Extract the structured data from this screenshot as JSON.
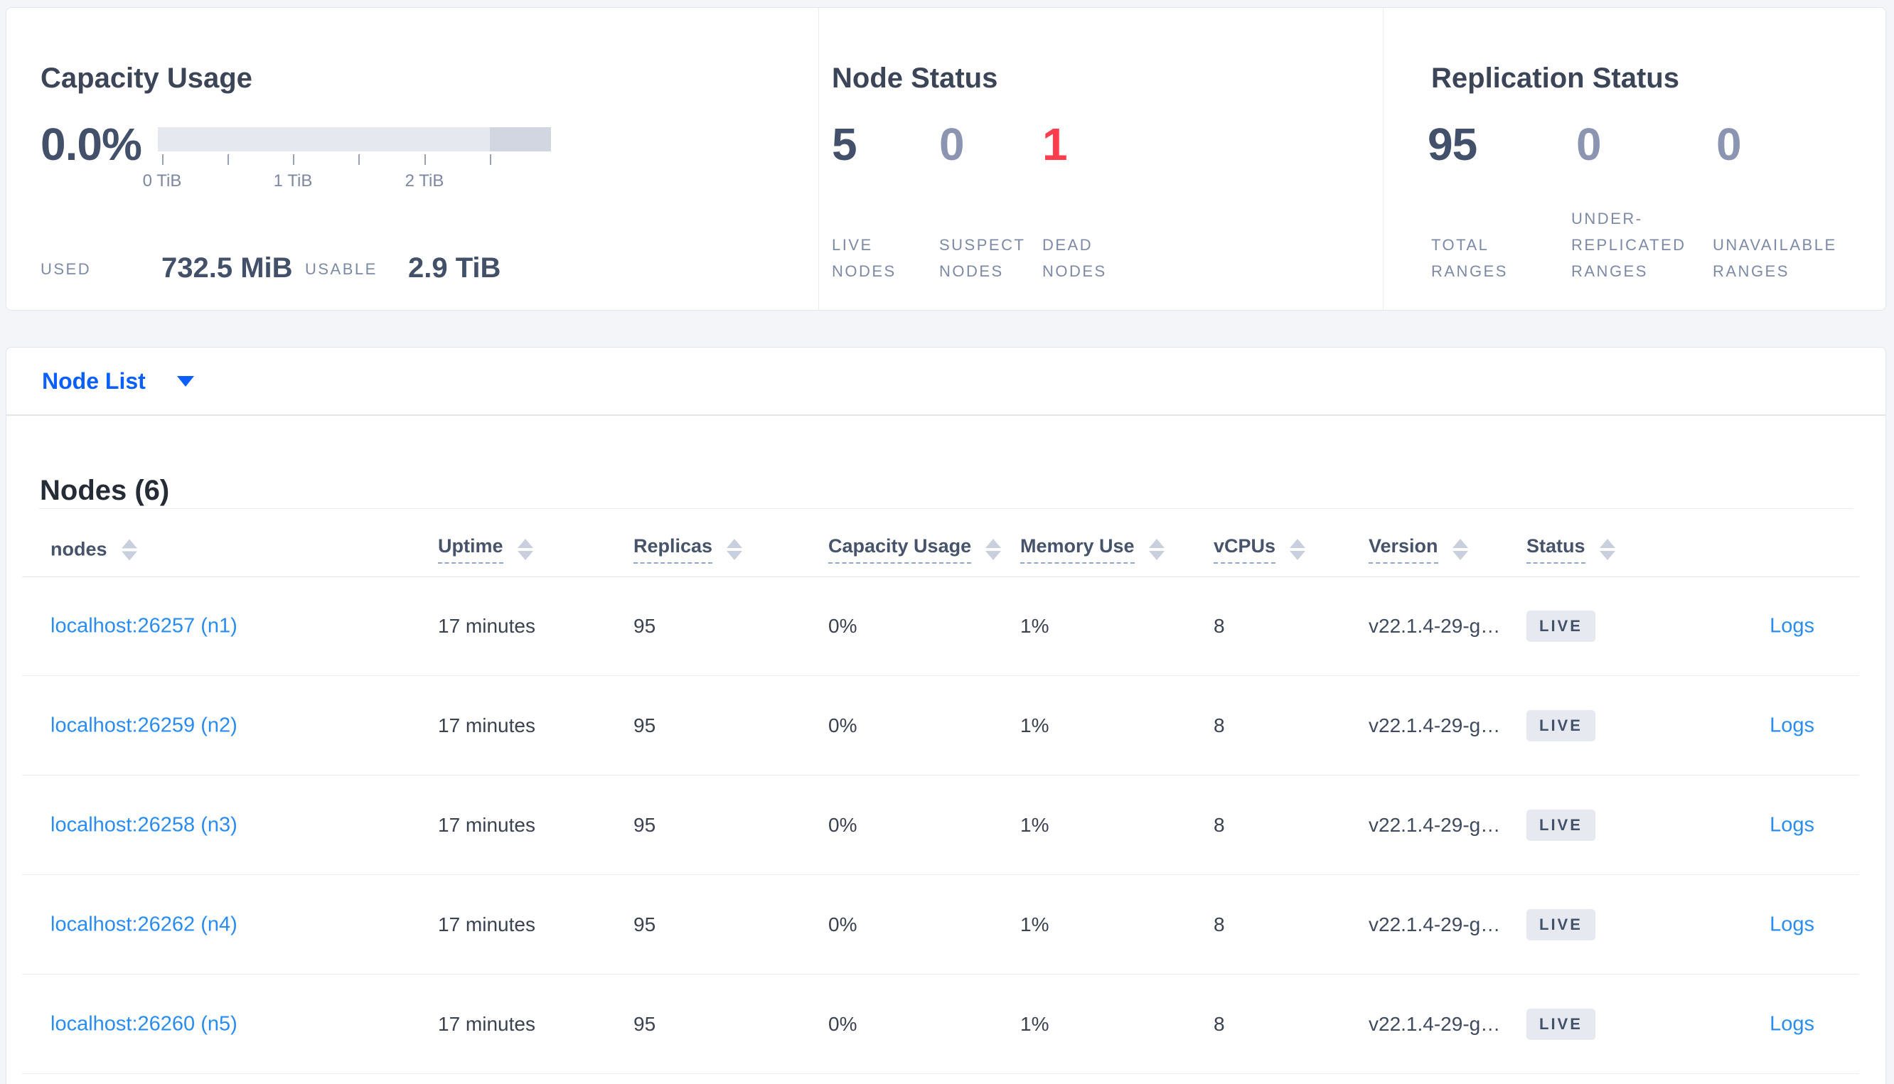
{
  "colors": {
    "accent_blue": "#0b5eff",
    "link_blue": "#2b8cf0",
    "danger_red": "#ff3d4c",
    "dark_slate": "#42506a",
    "muted_slate": "#8b95b1",
    "label_gray": "#7e89a5",
    "badge_bg": "#e6eaf0"
  },
  "summary": {
    "capacity": {
      "title": "Capacity Usage",
      "percent": "0.0%",
      "axis_ticks": [
        "0 TiB",
        "1 TiB",
        "2 TiB"
      ],
      "used_label": "USED",
      "used_value": "732.5 MiB",
      "usable_label": "USABLE",
      "usable_value": "2.9 TiB"
    },
    "node_status": {
      "title": "Node Status",
      "stats": [
        {
          "value": "5",
          "label_line1": "LIVE",
          "label_line2": "NODES"
        },
        {
          "value": "0",
          "label_line1": "SUSPECT",
          "label_line2": "NODES"
        },
        {
          "value": "1",
          "label_line1": "DEAD",
          "label_line2": "NODES"
        }
      ]
    },
    "replication": {
      "title": "Replication Status",
      "stats": [
        {
          "value": "95",
          "label_line1": "TOTAL",
          "label_line2": "RANGES"
        },
        {
          "value": "0",
          "label_line1": "UNDER-",
          "label_line2": "REPLICATED",
          "label_line3": "RANGES"
        },
        {
          "value": "0",
          "label_line1": "UNAVAILABLE",
          "label_line2": "RANGES"
        }
      ]
    }
  },
  "node_list": {
    "label": "Node List"
  },
  "nodes_table": {
    "heading": "Nodes (6)",
    "columns": {
      "nodes": "nodes",
      "uptime": "Uptime",
      "replicas": "Replicas",
      "capacity": "Capacity Usage",
      "memory": "Memory Use",
      "vcpus": "vCPUs",
      "version": "Version",
      "status": "Status"
    },
    "rows": [
      {
        "node": "localhost:26257 (n1)",
        "uptime": "17 minutes",
        "replicas": "95",
        "capacity": "0%",
        "memory": "1%",
        "vcpus": "8",
        "version": "v22.1.4-29-g…",
        "status": "LIVE",
        "logs": "Logs"
      },
      {
        "node": "localhost:26259 (n2)",
        "uptime": "17 minutes",
        "replicas": "95",
        "capacity": "0%",
        "memory": "1%",
        "vcpus": "8",
        "version": "v22.1.4-29-g…",
        "status": "LIVE",
        "logs": "Logs"
      },
      {
        "node": "localhost:26258 (n3)",
        "uptime": "17 minutes",
        "replicas": "95",
        "capacity": "0%",
        "memory": "1%",
        "vcpus": "8",
        "version": "v22.1.4-29-g…",
        "status": "LIVE",
        "logs": "Logs"
      },
      {
        "node": "localhost:26262 (n4)",
        "uptime": "17 minutes",
        "replicas": "95",
        "capacity": "0%",
        "memory": "1%",
        "vcpus": "8",
        "version": "v22.1.4-29-g…",
        "status": "LIVE",
        "logs": "Logs"
      },
      {
        "node": "localhost:26260 (n5)",
        "uptime": "17 minutes",
        "replicas": "95",
        "capacity": "0%",
        "memory": "1%",
        "vcpus": "8",
        "version": "v22.1.4-29-g…",
        "status": "LIVE",
        "logs": "Logs"
      }
    ]
  }
}
